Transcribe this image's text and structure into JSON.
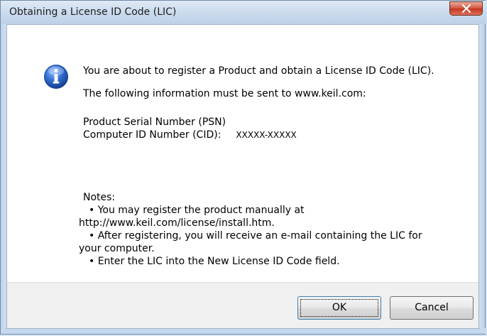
{
  "window": {
    "title": "Obtaining a License ID Code (LIC)",
    "close_symbol": "x"
  },
  "message": {
    "intro": "You are about to register a Product and obtain a License ID Code (LIC).",
    "send_info": "The following information must be sent to www.keil.com:",
    "psn_label": "Product Serial Number (PSN)",
    "cid_label": "Computer ID Number (CID):",
    "cid_value": "XXXXX-XXXXX",
    "notes_label": "Notes:",
    "note1_a": "• You may register the product manually at",
    "note1_b": "http://www.keil.com/license/install.htm.",
    "note2_a": "• After registering, you will receive an e-mail containing the LIC for",
    "note2_b": "your computer.",
    "note3": "• Enter the LIC into the New License ID Code field."
  },
  "buttons": {
    "ok_label": "OK",
    "cancel_label": "Cancel"
  },
  "icons": {
    "info_icon": "info-icon",
    "close_icon": "close-icon"
  },
  "colors": {
    "close_button_red": "#c2341f",
    "info_blue": "#2a65c8",
    "titlebar_blue": "#c9daed"
  }
}
